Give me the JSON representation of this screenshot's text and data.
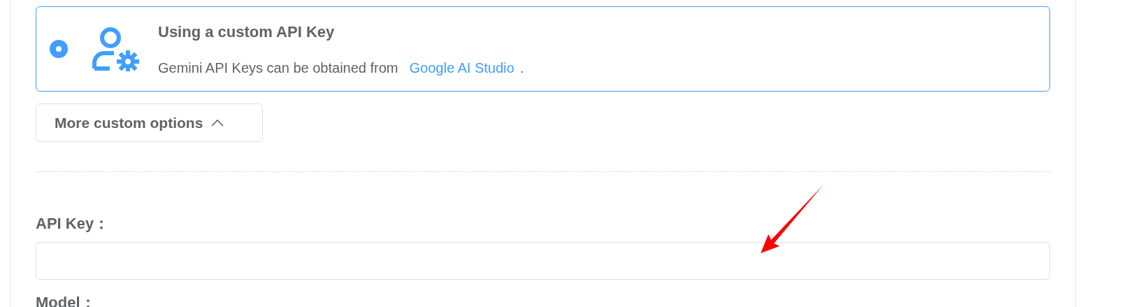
{
  "option": {
    "selected": true,
    "title": "Using a custom API Key",
    "description": "Gemini API Keys can be obtained from",
    "link": "Google AI Studio",
    "suffix": "."
  },
  "more_button": {
    "label": "More custom options",
    "expanded": true
  },
  "fields": [
    {
      "label": "API Key："
    },
    {
      "label": "Model："
    }
  ]
}
